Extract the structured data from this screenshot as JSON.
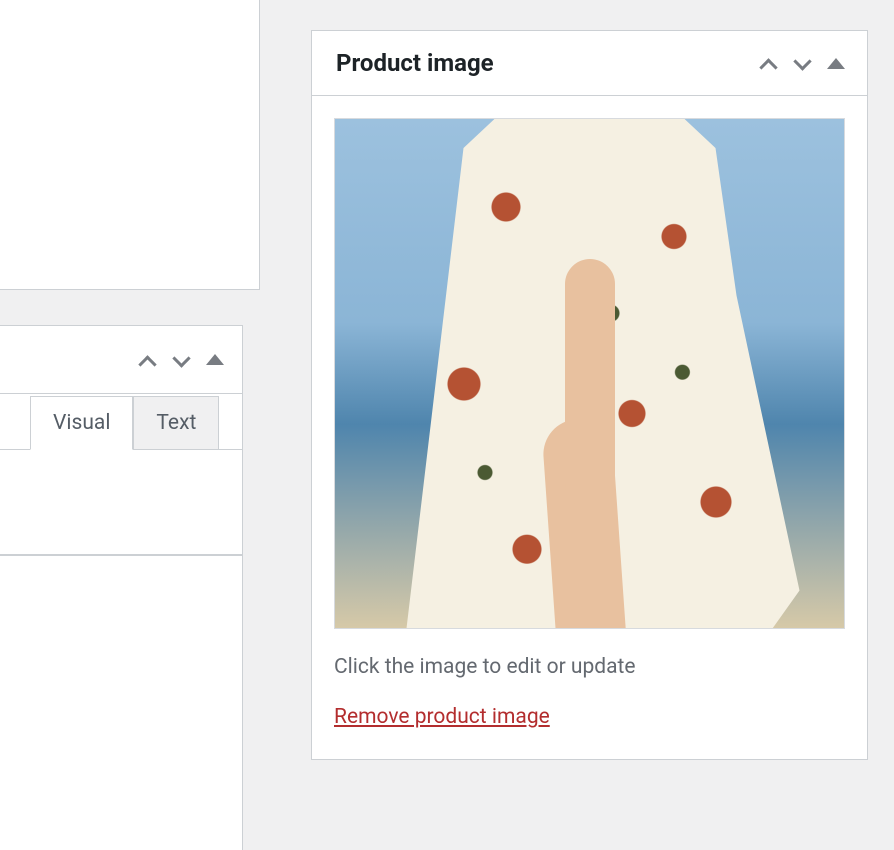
{
  "left_panel": {
    "tabs": [
      {
        "label": "Visual",
        "active": true
      },
      {
        "label": "Text",
        "active": false
      }
    ]
  },
  "product_image_panel": {
    "title": "Product image",
    "helper_text": "Click the image to edit or update",
    "remove_link": "Remove product image",
    "image_alt": "Floral wrap dress product photo"
  }
}
